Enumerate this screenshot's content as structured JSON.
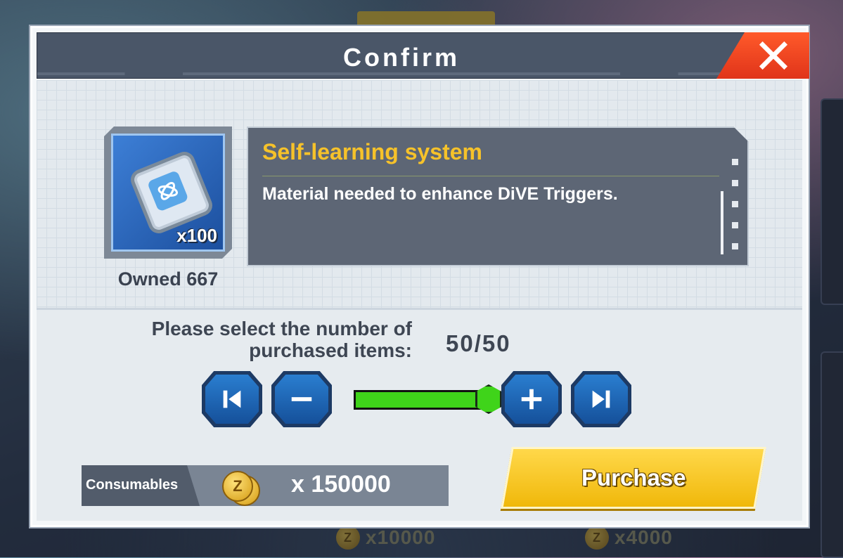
{
  "dialog": {
    "title": "Confirm",
    "close_icon": "close-x-icon"
  },
  "item": {
    "name": "Self-learning system",
    "description": "Material needed to enhance DiVE Triggers.",
    "quantity_badge": "x100",
    "owned_text": "Owned 667",
    "icon": "chip-icon"
  },
  "quantity_selector": {
    "label": "Please select the number of purchased items:",
    "count_text": "50/50",
    "selected": 50,
    "max": 50,
    "slider_fraction": 1.0,
    "buttons": [
      "first-icon",
      "minus-icon",
      "plus-icon",
      "last-icon"
    ]
  },
  "cost": {
    "label": "Consumables",
    "amount": "x 150000",
    "currency_icon": "z-coin-icon"
  },
  "purchase_label": "Purchase",
  "background_prices": [
    "x10000",
    "x4000"
  ],
  "colors": {
    "accent_yellow": "#f6c22a",
    "close_red": "#e0341a",
    "slider_green": "#3fd41a",
    "button_blue": "#1d5fa8"
  }
}
